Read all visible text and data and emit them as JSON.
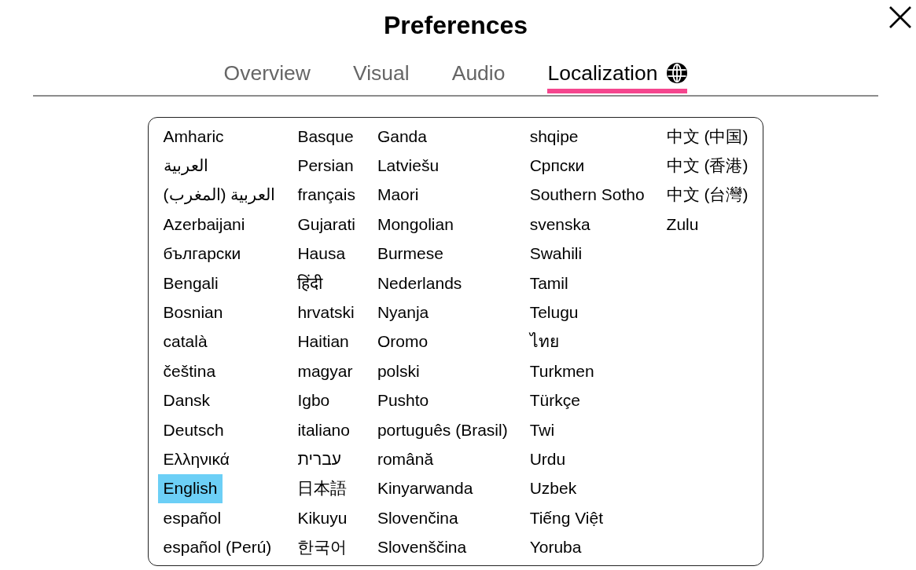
{
  "dialog": {
    "title": "Preferences"
  },
  "tabs": [
    {
      "label": "Overview",
      "selected": false,
      "has_icon": false
    },
    {
      "label": "Visual",
      "selected": false,
      "has_icon": false
    },
    {
      "label": "Audio",
      "selected": false,
      "has_icon": false
    },
    {
      "label": "Localization",
      "selected": true,
      "has_icon": true
    }
  ],
  "languages": [
    {
      "label": "Amharic",
      "selected": false
    },
    {
      "label": "العربية",
      "selected": false
    },
    {
      "label": "العربية (المغرب)",
      "selected": false
    },
    {
      "label": "Azerbaijani",
      "selected": false
    },
    {
      "label": "български",
      "selected": false
    },
    {
      "label": "Bengali",
      "selected": false
    },
    {
      "label": "Bosnian",
      "selected": false
    },
    {
      "label": "català",
      "selected": false
    },
    {
      "label": "čeština",
      "selected": false
    },
    {
      "label": "Dansk",
      "selected": false
    },
    {
      "label": "Deutsch",
      "selected": false
    },
    {
      "label": "Ελληνικά",
      "selected": false
    },
    {
      "label": "English",
      "selected": true
    },
    {
      "label": "español",
      "selected": false
    },
    {
      "label": "español (Perú)",
      "selected": false
    },
    {
      "label": "Basque",
      "selected": false
    },
    {
      "label": "Persian",
      "selected": false
    },
    {
      "label": "français",
      "selected": false
    },
    {
      "label": "Gujarati",
      "selected": false
    },
    {
      "label": "Hausa",
      "selected": false
    },
    {
      "label": "हिंदी",
      "selected": false
    },
    {
      "label": "hrvatski",
      "selected": false
    },
    {
      "label": "Haitian",
      "selected": false
    },
    {
      "label": "magyar",
      "selected": false
    },
    {
      "label": "Igbo",
      "selected": false
    },
    {
      "label": "italiano",
      "selected": false
    },
    {
      "label": "עברית",
      "selected": false
    },
    {
      "label": "日本語",
      "selected": false
    },
    {
      "label": "Kikuyu",
      "selected": false
    },
    {
      "label": "한국어",
      "selected": false
    },
    {
      "label": "Ganda",
      "selected": false
    },
    {
      "label": "Latviešu",
      "selected": false
    },
    {
      "label": "Maori",
      "selected": false
    },
    {
      "label": "Mongolian",
      "selected": false
    },
    {
      "label": "Burmese",
      "selected": false
    },
    {
      "label": "Nederlands",
      "selected": false
    },
    {
      "label": "Nyanja",
      "selected": false
    },
    {
      "label": "Oromo",
      "selected": false
    },
    {
      "label": "polski",
      "selected": false
    },
    {
      "label": "Pushto",
      "selected": false
    },
    {
      "label": "português (Brasil)",
      "selected": false
    },
    {
      "label": "română",
      "selected": false
    },
    {
      "label": "Kinyarwanda",
      "selected": false
    },
    {
      "label": "Slovenčina",
      "selected": false
    },
    {
      "label": "Slovenščina",
      "selected": false
    },
    {
      "label": "shqipe",
      "selected": false
    },
    {
      "label": "Српски",
      "selected": false
    },
    {
      "label": "Southern Sotho",
      "selected": false
    },
    {
      "label": "svenska",
      "selected": false
    },
    {
      "label": "Swahili",
      "selected": false
    },
    {
      "label": "Tamil",
      "selected": false
    },
    {
      "label": "Telugu",
      "selected": false
    },
    {
      "label": "ไทย",
      "selected": false
    },
    {
      "label": "Turkmen",
      "selected": false
    },
    {
      "label": "Türkçe",
      "selected": false
    },
    {
      "label": "Twi",
      "selected": false
    },
    {
      "label": "Urdu",
      "selected": false
    },
    {
      "label": "Uzbek",
      "selected": false
    },
    {
      "label": "Tiếng Việt",
      "selected": false
    },
    {
      "label": "Yoruba",
      "selected": false
    },
    {
      "label": "中文 (中国)",
      "selected": false
    },
    {
      "label": "中文 (香港)",
      "selected": false
    },
    {
      "label": "中文 (台灣)",
      "selected": false
    },
    {
      "label": "Zulu",
      "selected": false
    }
  ]
}
